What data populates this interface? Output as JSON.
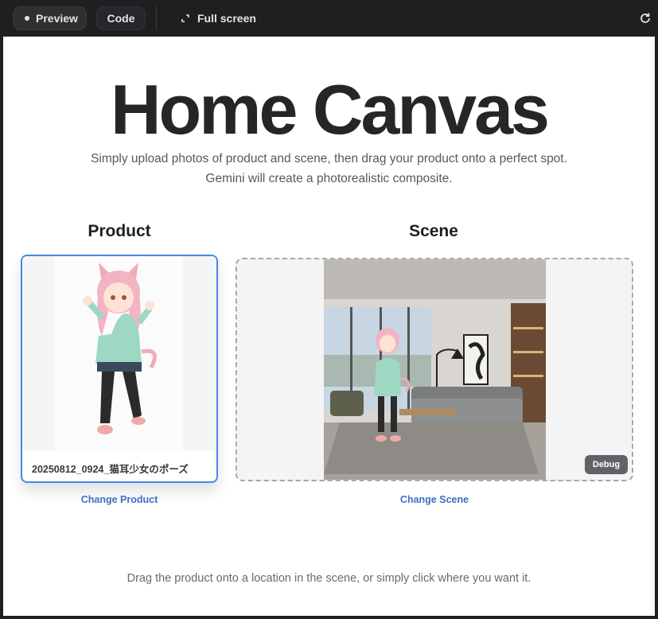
{
  "toolbar": {
    "preview_label": "Preview",
    "code_label": "Code",
    "fullscreen_label": "Full screen",
    "icons": {
      "fullscreen": "expand-icon",
      "refresh": "refresh-icon"
    }
  },
  "page": {
    "title": "Home Canvas",
    "subtitle_line1": "Simply upload photos of product and scene, then drag your product onto a perfect spot.",
    "subtitle_line2": "Gemini will create a photorealistic composite.",
    "hint": "Drag the product onto a location in the scene, or simply click where you want it."
  },
  "product": {
    "heading": "Product",
    "filename": "20250812_0924_猫耳少女のポーズ",
    "change_label": "Change Product"
  },
  "scene": {
    "heading": "Scene",
    "debug_label": "Debug",
    "change_label": "Change Scene"
  },
  "colors": {
    "accent": "#4a86e8",
    "link": "#3b6fc6",
    "toolbar_bg": "#1e1f20"
  }
}
